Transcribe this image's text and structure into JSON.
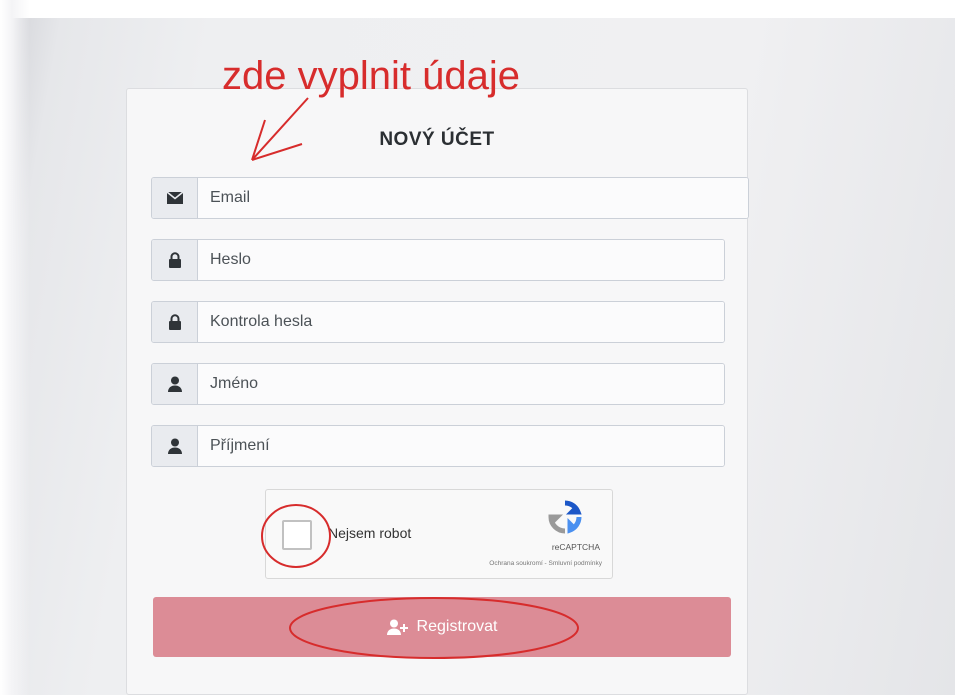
{
  "annotation": {
    "text": "zde vyplnit údaje",
    "color": "#d72c2c"
  },
  "form": {
    "title": "NOVÝ ÚČET",
    "fields": [
      {
        "placeholder": "Email",
        "icon": "envelope-icon"
      },
      {
        "placeholder": "Heslo",
        "icon": "lock-icon"
      },
      {
        "placeholder": "Kontrola hesla",
        "icon": "lock-icon"
      },
      {
        "placeholder": "Jméno",
        "icon": "user-icon"
      },
      {
        "placeholder": "Příjmení",
        "icon": "user-icon"
      }
    ],
    "recaptcha": {
      "label": "Nejsem robot",
      "brand": "reCAPTCHA",
      "terms": "Ochrana soukromí - Smluvní podmínky"
    },
    "submit": {
      "label": "Registrovat",
      "icon": "user-plus-icon"
    }
  },
  "colors": {
    "submit_bg": "#dc8c96",
    "addon_bg": "#e9ebef"
  }
}
